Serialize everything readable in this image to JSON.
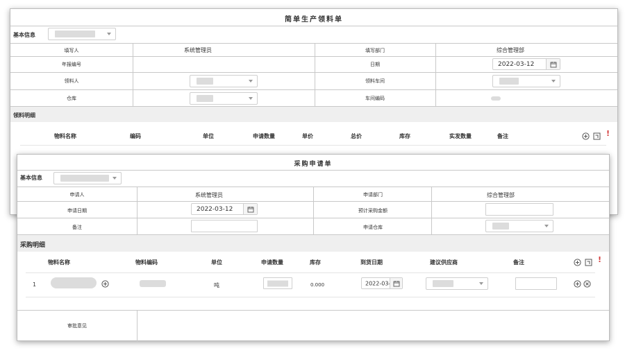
{
  "requisition": {
    "title": "简单生产领料单",
    "basic_info_label": "基本信息",
    "fields": {
      "filler_label": "填写人",
      "filler_value": "系统管理员",
      "fill_dept_label": "填写部门",
      "fill_dept_value": "综合管理部",
      "year_code_label": "年报编号",
      "date_label": "日期",
      "date_value": "2022-03-12",
      "picker_label": "领料人",
      "workshop_label": "领料车间",
      "warehouse_label": "仓库",
      "workshop_code_label": "车间编码"
    },
    "detail_label": "领料明细",
    "columns": [
      "物料名称",
      "编码",
      "单位",
      "申请数量",
      "单价",
      "总价",
      "库存",
      "实发数量",
      "备注"
    ],
    "required_mark": "!"
  },
  "purchase": {
    "title": "采购申请单",
    "basic_info_label": "基本信息",
    "fields": {
      "applicant_label": "申请人",
      "applicant_value": "系统管理员",
      "apply_dept_label": "申请部门",
      "apply_dept_value": "综合管理部",
      "apply_date_label": "申请日期",
      "apply_date_value": "2022-03-12",
      "estimated_amount_label": "预计采购金额",
      "remark_label": "备注",
      "apply_warehouse_label": "申请仓库"
    },
    "detail_label": "采购明细",
    "columns": [
      "物料名称",
      "物料编码",
      "单位",
      "申请数量",
      "库存",
      "到货日期",
      "建议供应商",
      "备注"
    ],
    "required_mark": "!",
    "rows": [
      {
        "index": "1",
        "unit": "吨",
        "stock": "0.000",
        "arrival_date": "2022-03-"
      }
    ],
    "approval_label": "审批意见"
  },
  "icons": {
    "add": "plus-circle-icon",
    "select": "select-box-icon",
    "remove": "close-circle-icon",
    "calendar": "calendar-icon"
  }
}
